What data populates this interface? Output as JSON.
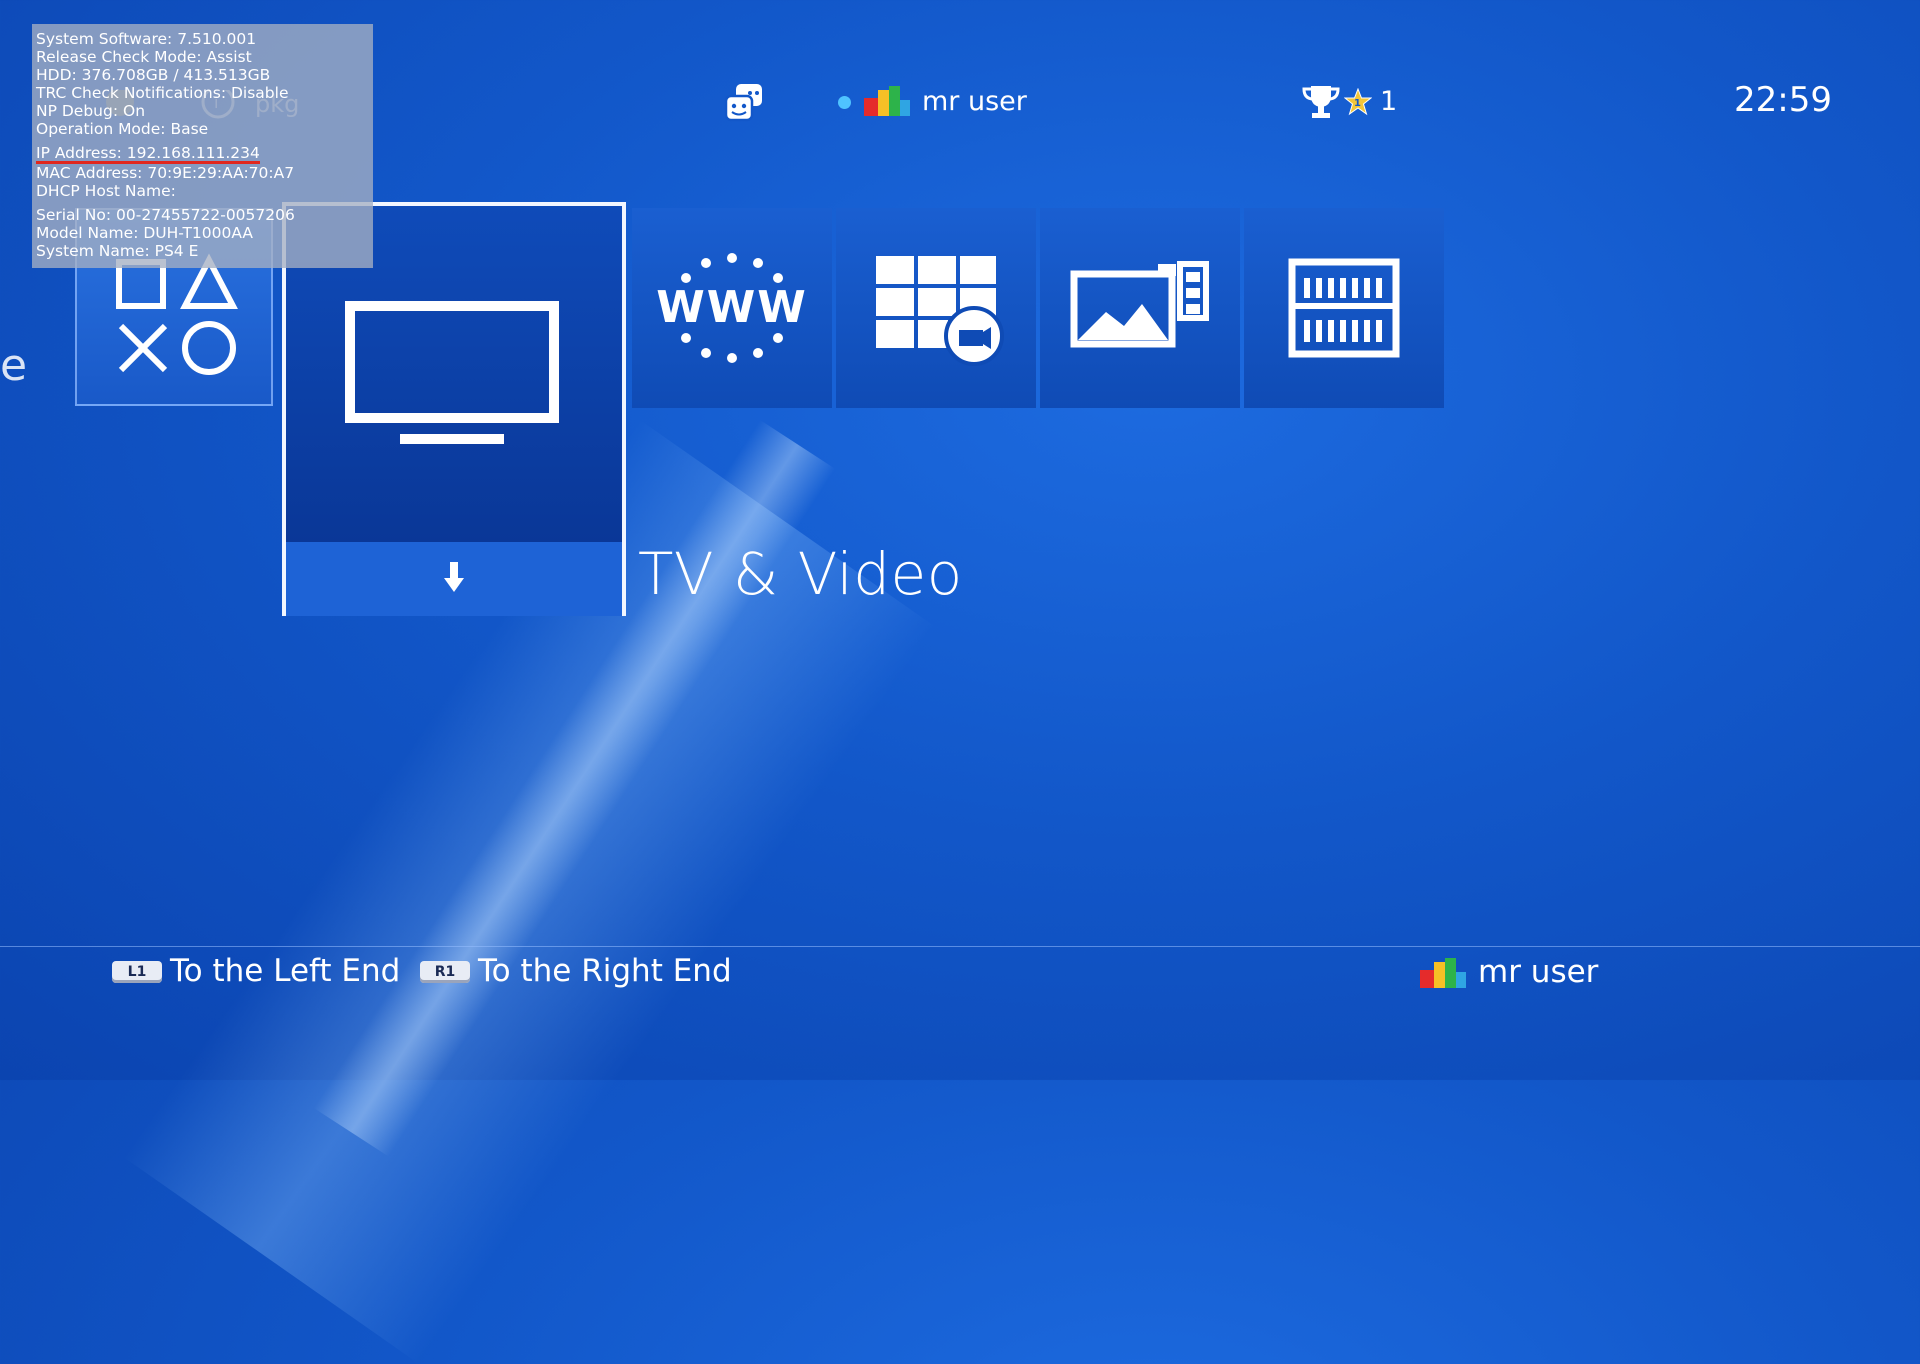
{
  "debug_overlay": {
    "lines": [
      "System Software:  7.510.001",
      "Release Check Mode: Assist",
      "HDD: 376.708GB / 413.513GB",
      "TRC Check Notifications: Disable",
      "NP Debug: On",
      "Operation Mode: Base",
      "IP Address: 192.168.111.234",
      "MAC Address: 70:9E:29:AA:70:A7",
      "DHCP Host Name:",
      "Serial No: 00-27455722-0057206",
      "Model Name: DUH-T1000AA",
      "System Name: PS4 E"
    ]
  },
  "top_bar": {
    "user_name": "mr user",
    "trophy_count": "1",
    "clock": "22:59",
    "faded_text": "pkg"
  },
  "content": {
    "selected_tile_title": "TV & Video",
    "edge_letter": "e",
    "tiles": [
      {
        "name": "playstation-tile",
        "icon": "ps-symbols-icon"
      },
      {
        "name": "tv-video-tile",
        "icon": "tv-icon"
      },
      {
        "name": "internet-browser-tile",
        "icon": "www-icon"
      },
      {
        "name": "store-tile",
        "icon": "store-grid-icon"
      },
      {
        "name": "capture-gallery-tile",
        "icon": "gallery-icon"
      },
      {
        "name": "library-tile",
        "icon": "library-icon"
      }
    ]
  },
  "bottom_bar": {
    "l1_key": "L1",
    "l1_label": "To the Left End",
    "r1_key": "R1",
    "r1_label": "To the Right End",
    "user_name": "mr user"
  },
  "colors": {
    "background": "#1257c9",
    "selected_border": "#f2f6ff",
    "online_dot": "#4fc3ff",
    "debug_underline": "#e0271e"
  }
}
